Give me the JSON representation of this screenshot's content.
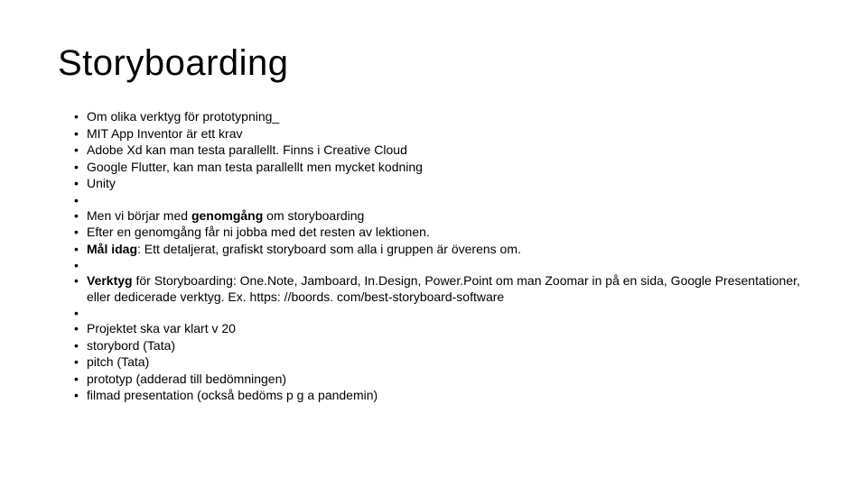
{
  "title": "Storyboarding",
  "bullets": {
    "b1": "Om olika verktyg för prototypning_",
    "b2": "MIT App Inventor är ett krav",
    "b3": "Adobe Xd kan man testa parallellt. Finns i Creative Cloud",
    "b4": "Google Flutter, kan man testa parallellt men mycket kodning",
    "b5": "Unity",
    "b6a": "Men vi börjar med ",
    "b6b": "genomgång",
    "b6c": " om storyboarding",
    "b7": "Efter en genomgång får ni jobba med det resten av lektionen.",
    "b8a": "Mål idag",
    "b8b": ": Ett detaljerat, grafiskt storyboard som alla i gruppen är överens om.",
    "b9a": "Verktyg",
    "b9b": " för Storyboarding: One.Note, Jamboard, In.Design, Power.Point om man Zoomar in på en sida, Google Presentationer, eller dedicerade verktyg. Ex. https: //boords. com/best-storyboard-software",
    "b10": "Projektet ska var klart v 20",
    "b11": "storybord (Tata)",
    "b12": "pitch (Tata)",
    "b13": "prototyp (adderad till bedömningen)",
    "b14": "filmad presentation (också bedöms p g a pandemin)"
  }
}
